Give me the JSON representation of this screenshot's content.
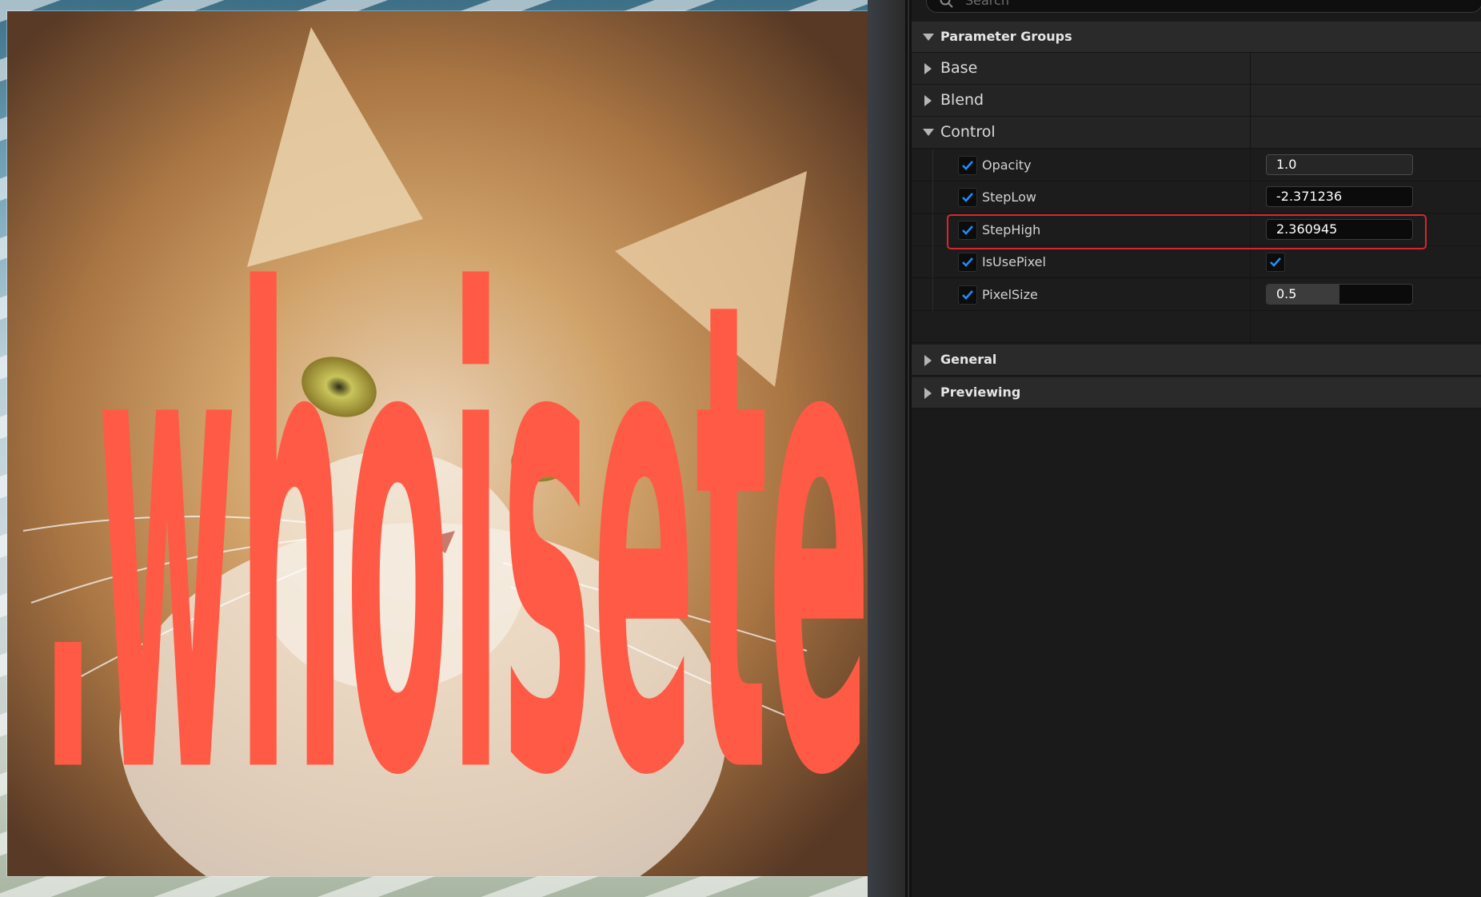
{
  "viewport": {
    "preview_subject": "cat-photo",
    "overlay_text": ".whoisete",
    "overlay_color": "#ff5a45"
  },
  "panel": {
    "search": {
      "placeholder": "Search"
    },
    "categories": {
      "parameter_groups": "Parameter Groups",
      "general": "General",
      "previewing": "Previewing"
    },
    "groups": {
      "base": "Base",
      "blend": "Blend",
      "control": "Control"
    },
    "properties": [
      {
        "label": "Opacity",
        "value": "1.0",
        "enabled": true
      },
      {
        "label": "StepLow",
        "value": "-2.371236",
        "enabled": true
      },
      {
        "label": "StepHigh",
        "value": "2.360945",
        "enabled": true,
        "highlighted": true
      },
      {
        "label": "IsUsePixel",
        "value": true,
        "enabled": true
      },
      {
        "label": "PixelSize",
        "value": "0.5",
        "slider_fraction": 0.5,
        "enabled": true
      }
    ]
  },
  "colors": {
    "accent_check": "#1e8fff",
    "highlight_border": "#d9262e",
    "panel_bg": "#1a1a1a"
  }
}
